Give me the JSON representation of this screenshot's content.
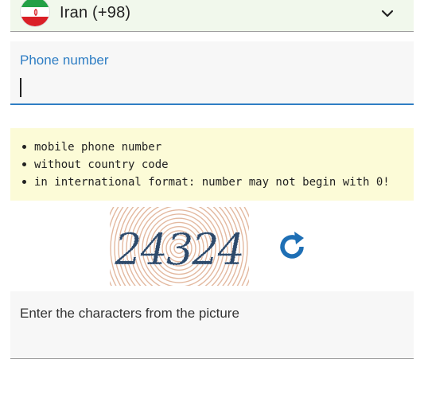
{
  "country_select": {
    "selected": "Iran (+98)",
    "flag_icon": "iran-flag-icon",
    "dropdown_icon": "chevron-down-icon"
  },
  "phone": {
    "label": "Phone number",
    "value": ""
  },
  "hints": [
    "mobile phone number",
    "without country code",
    "in international format: number may not begin with 0!"
  ],
  "captcha": {
    "image_text": "24324",
    "refresh_icon": "refresh-icon",
    "text_color": "#2e4a6b",
    "ring_color": "#e3b9a0"
  },
  "captcha_input": {
    "label": "Enter the characters from the picture",
    "value": ""
  },
  "colors": {
    "accent": "#2f7ec4",
    "country_bg": "#f1f8ec",
    "hint_bg": "#fcfbd7"
  }
}
